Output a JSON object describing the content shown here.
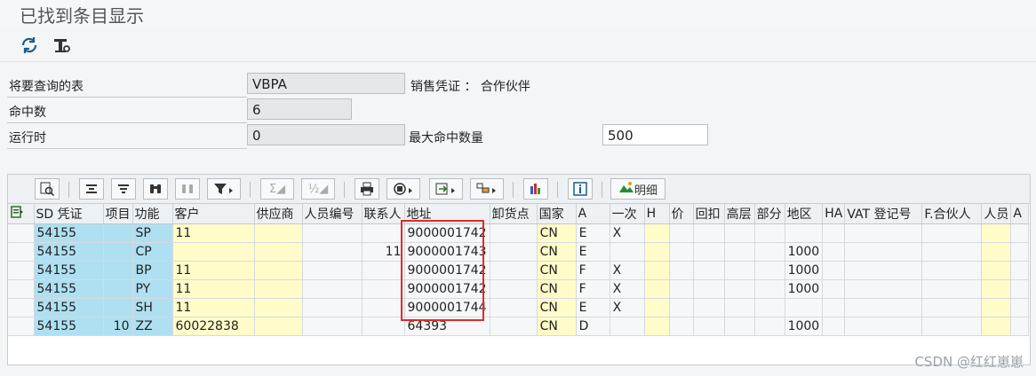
{
  "window": {
    "title": "已找到条目显示"
  },
  "toolbar": {
    "icons": [
      "refresh-icon",
      "settings-icon"
    ]
  },
  "form": {
    "table_label": "将要查询的表",
    "table_value": "VBPA",
    "table_desc": "销售凭证 ： 合作伙伴",
    "hits_label": "命中数",
    "hits_value": "6",
    "runtime_label": "运行时",
    "runtime_value": "0",
    "max_hits_label": "最大命中数量",
    "max_hits_value": "500"
  },
  "grid_toolbar": {
    "detail_label": "明细"
  },
  "columns": [
    "SD 凭证",
    "项目",
    "功能",
    "客户",
    "供应商",
    "人员编号",
    "联系人",
    "地址",
    "卸货点",
    "国家",
    "A",
    "一次",
    "H",
    "价",
    "回扣",
    "高层",
    "部分",
    "地区",
    "HA",
    "VAT 登记号",
    "F.合伙人",
    "人员",
    "A"
  ],
  "rows": [
    [
      "54155",
      "",
      "SP",
      "11",
      "",
      "",
      "",
      "9000001742",
      "",
      "CN",
      "E",
      "X",
      "",
      "",
      "",
      "",
      "",
      "",
      "",
      "",
      "",
      "",
      ""
    ],
    [
      "54155",
      "",
      "CP",
      "",
      "",
      "",
      "11",
      "9000001743",
      "",
      "CN",
      "E",
      "",
      "",
      "",
      "",
      "",
      "",
      "1000",
      "",
      "",
      "",
      "",
      ""
    ],
    [
      "54155",
      "",
      "BP",
      "11",
      "",
      "",
      "",
      "9000001742",
      "",
      "CN",
      "F",
      "X",
      "",
      "",
      "",
      "",
      "",
      "1000",
      "",
      "",
      "",
      "",
      ""
    ],
    [
      "54155",
      "",
      "PY",
      "11",
      "",
      "",
      "",
      "9000001742",
      "",
      "CN",
      "F",
      "X",
      "",
      "",
      "",
      "",
      "",
      "1000",
      "",
      "",
      "",
      "",
      ""
    ],
    [
      "54155",
      "",
      "SH",
      "11",
      "",
      "",
      "",
      "9000001744",
      "",
      "CN",
      "E",
      "X",
      "",
      "",
      "",
      "",
      "",
      "",
      "",
      "",
      "",
      "",
      ""
    ],
    [
      "54155",
      "10",
      "ZZ",
      "60022838",
      "",
      "",
      "",
      "64393",
      "",
      "CN",
      "D",
      "",
      "",
      "",
      "",
      "",
      "",
      "1000",
      "",
      "",
      "",
      "",
      ""
    ]
  ],
  "watermark": "CSDN @红红崽崽"
}
